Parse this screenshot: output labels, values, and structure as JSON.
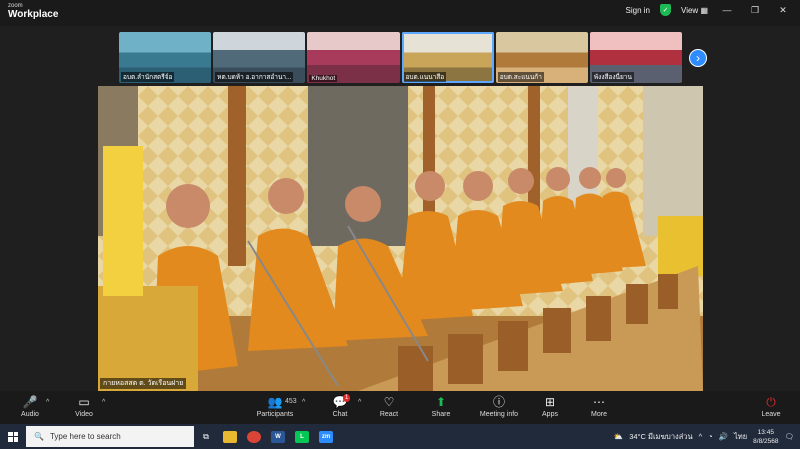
{
  "window": {
    "brand_small": "zoom",
    "brand_big": "Workplace",
    "sign_in": "Sign in",
    "view": "View"
  },
  "gallery": [
    {
      "name": "อบต.ลำนักสตรีจ์อ"
    },
    {
      "name": "หต.บดห้า อ.อากาสอำนา..."
    },
    {
      "name": "Khukhot"
    },
    {
      "name": "อบต.แนนาสีอ"
    },
    {
      "name": "อบต.สะแนนก้า"
    },
    {
      "name": "พังงสีองนี่ยาน"
    }
  ],
  "main_video": {
    "speaker_name": "กายหอสสต ต. วัดเรือนฝาย"
  },
  "toolbar": {
    "audio": "Audio",
    "video": "Video",
    "participants": "Participants",
    "participants_count": "453",
    "chat": "Chat",
    "chat_badge": "1",
    "react": "React",
    "share": "Share",
    "meeting_info": "Meeting info",
    "apps": "Apps",
    "more": "More",
    "leave": "Leave"
  },
  "taskbar": {
    "search_placeholder": "Type here to search",
    "weather": "34°C  มีเมฆบางส่วน",
    "lang": "ไทย",
    "time": "13:45",
    "date": "8/8/2568"
  },
  "colors": {
    "accent": "#2d8cff",
    "share_green": "#1db954",
    "leave_red": "#e02828"
  }
}
